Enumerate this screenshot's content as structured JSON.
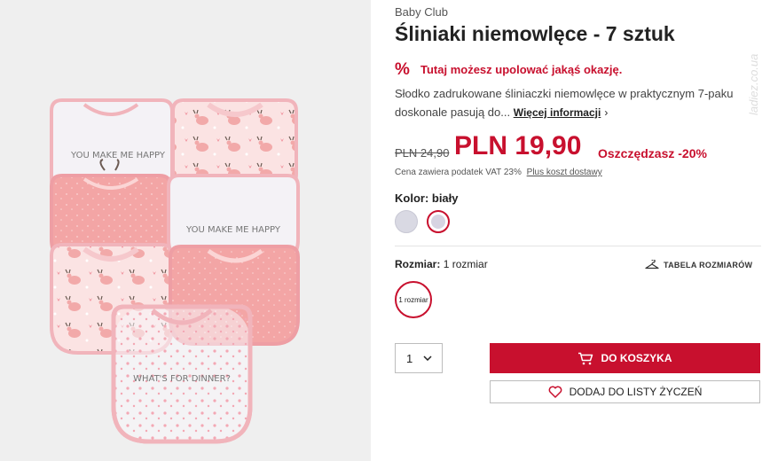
{
  "product": {
    "brand": "Baby Club",
    "title": "Śliniaki niemowlęce - 7 sztuk",
    "image_text": {
      "bib_1": "YOU MAKE ME HAPPY",
      "bib_2": "YOU MAKE ME HAPPY",
      "bib_3": "WHAT'S FOR DINNER?"
    }
  },
  "promo": {
    "icon": "percent-icon",
    "text": "Tutaj możesz upolować jakąś okazję."
  },
  "description": {
    "line1": "Słodko zadrukowane śliniaczki niemowlęce w praktycznym 7-paku",
    "line2": "doskonale pasują do...",
    "more_label": "Więcej informacji"
  },
  "price": {
    "old": "PLN 24,90",
    "current": "PLN 19,90",
    "savings": "Oszczędzasz -20%",
    "vat_note": "Cena zawiera podatek VAT 23%",
    "shipping_link": "Plus koszt dostawy"
  },
  "color": {
    "label": "Kolor: biały",
    "swatches": [
      "#d9d9e3",
      "#d7d4e2"
    ],
    "selected_index": 1
  },
  "size": {
    "label": "Rozmiar:",
    "value": "1 rozmiar",
    "table_label": "TABELA ROZMIARÓW",
    "options": [
      "1 rozmiar"
    ]
  },
  "purchase": {
    "quantity": "1",
    "add_to_cart": "DO KOSZYKA",
    "add_to_wishlist": "DODAJ DO LISTY ŻYCZEŃ"
  },
  "watermark": "ladiez.co.ua",
  "colors": {
    "accent": "#c8102e",
    "image_bg": "#efefef",
    "pink": "#f0a3a8"
  }
}
